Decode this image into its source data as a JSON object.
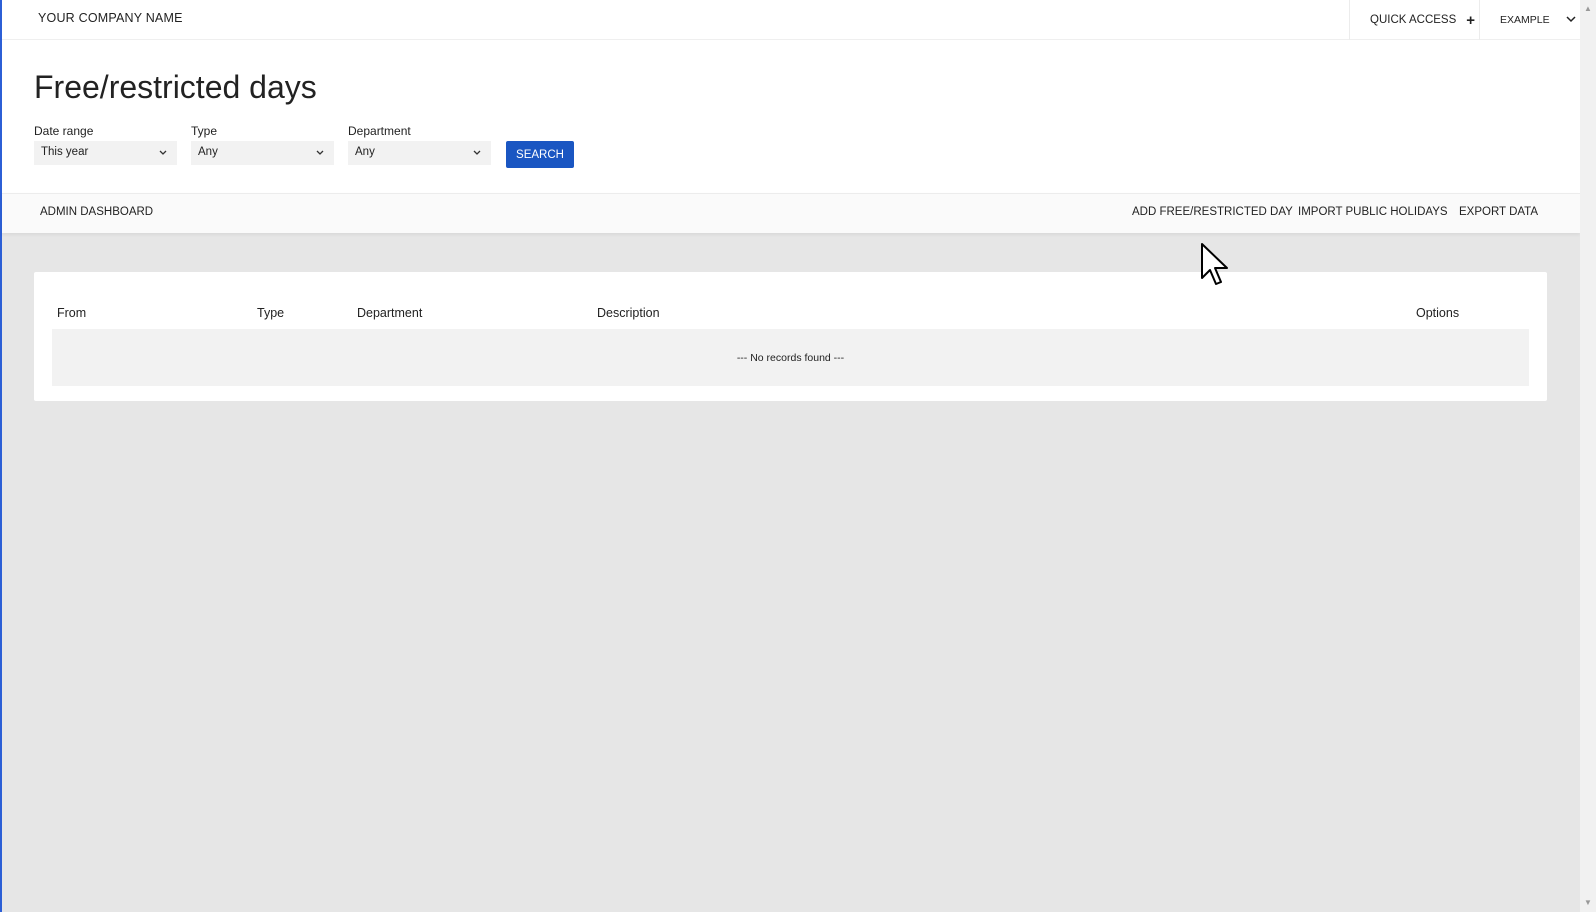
{
  "topbar": {
    "company_name": "YOUR COMPANY NAME",
    "quick_access": "QUICK ACCESS",
    "quick_access_icon": "plus-icon",
    "user_name": "EXAMPLE",
    "user_menu_icon": "chevron-down-icon"
  },
  "header": {
    "title": "Free/restricted days",
    "filters": {
      "date_range": {
        "label": "Date range",
        "value": "This year"
      },
      "type": {
        "label": "Type",
        "value": "Any"
      },
      "department": {
        "label": "Department",
        "value": "Any"
      }
    },
    "search_label": "SEARCH"
  },
  "actionbar": {
    "dashboard": "ADMIN DASHBOARD",
    "add": "ADD FREE/RESTRICTED DAY",
    "import": "IMPORT PUBLIC HOLIDAYS",
    "export": "EXPORT DATA"
  },
  "table": {
    "columns": [
      "From",
      "Type",
      "Department",
      "Description",
      "Options"
    ],
    "empty_message": "--- No records found ---"
  },
  "colors": {
    "accent": "#1a56c2",
    "background": "#e6e6e6"
  }
}
